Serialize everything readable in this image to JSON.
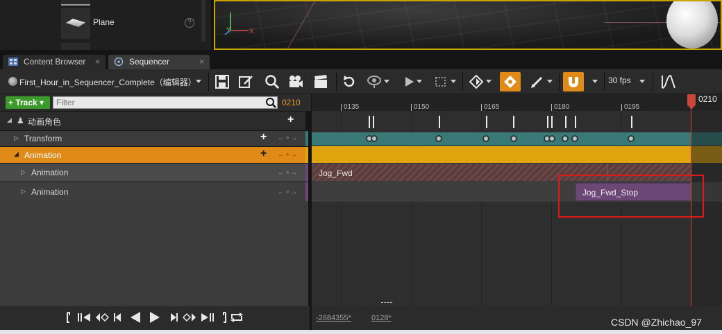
{
  "content_browser": {
    "asset_label": "Plane",
    "help_label": "?"
  },
  "viewport": {
    "gizmo_y": "Y",
    "gizmo_x": "X"
  },
  "tabs": [
    {
      "label": "Content Browser",
      "close": "×"
    },
    {
      "label": "Sequencer",
      "close": "×"
    }
  ],
  "toolbar": {
    "sequence_name": "First_Hour_in_Sequencer_Complete（编辑器）",
    "fps": "30 fps",
    "icons": [
      "save-icon",
      "edit-icon",
      "search-icon",
      "camera-icon",
      "clapper-icon",
      "refresh-icon",
      "eye-icon",
      "play-icon",
      "selection-icon",
      "key-icon",
      "autokey-icon",
      "pen-icon",
      "snap-magnet-icon",
      "curve-icon"
    ]
  },
  "track_header": {
    "track_button": "Track",
    "filter_placeholder": "Filter",
    "current_frame": "0210"
  },
  "tracks": [
    {
      "label": "动画角色",
      "indent": 0
    },
    {
      "label": "Transform",
      "indent": 1
    },
    {
      "label": "Animation",
      "indent": 1,
      "selected": true
    },
    {
      "label": "Animation",
      "indent": 2
    },
    {
      "label": "Animation",
      "indent": 2
    }
  ],
  "key_nav": "←∘→",
  "add_symbol": "+",
  "ruler": {
    "labels": [
      "0135",
      "0150",
      "0165",
      "0180",
      "0195"
    ],
    "playhead_label": "0210"
  },
  "sections": {
    "jog": "Jog_Fwd",
    "stop": "Jog_Fwd_Stop"
  },
  "range": {
    "start": "-2684355*",
    "end": "0128*"
  },
  "watermark": "CSDN @Zhichao_97",
  "colors": {
    "accent_orange": "#e08a18",
    "transform_lane": "#397a79",
    "animation_lane": "#e0a40e",
    "stop_section": "#6b4775",
    "playhead": "#c8463a",
    "annotation_red": "#e01818"
  }
}
